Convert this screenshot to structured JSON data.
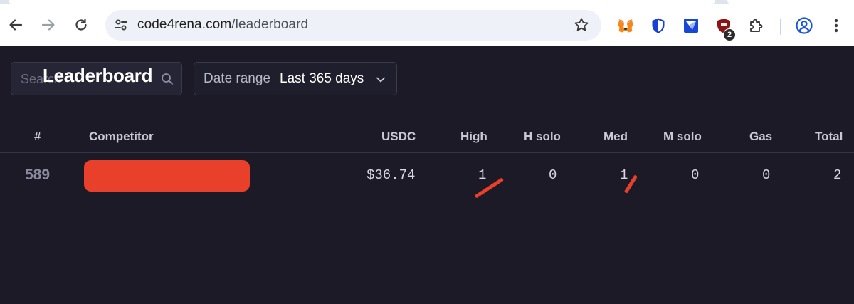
{
  "browser": {
    "url_domain": "code4rena.com",
    "url_path": "/leaderboard",
    "extension_badge": "2",
    "icons": [
      "back-arrow-icon",
      "forward-arrow-icon",
      "reload-icon",
      "site-settings-icon",
      "bookmark-star-icon",
      "metamask-fox-icon",
      "shield-icon",
      "wallet-extension-icon",
      "red-shield-extension-icon",
      "puzzle-extensions-icon",
      "profile-icon",
      "kebab-menu-icon"
    ]
  },
  "page": {
    "title": "Leaderboard",
    "search_placeholder": "Search",
    "date_range_label": "Date range",
    "date_range_value": "Last 365 days"
  },
  "table": {
    "headers": {
      "rank": "#",
      "competitor": "Competitor",
      "usdc": "USDC",
      "high": "High",
      "h_solo": "H solo",
      "med": "Med",
      "m_solo": "M solo",
      "gas": "Gas",
      "total": "Total"
    },
    "rows": [
      {
        "rank": "589",
        "competitor": "",
        "usdc": "$36.74",
        "high": "1",
        "h_solo": "0",
        "med": "1",
        "m_solo": "0",
        "gas": "0",
        "total": "2"
      }
    ]
  },
  "colors": {
    "page_bg": "#1b1a26",
    "redaction": "#e8402a"
  }
}
